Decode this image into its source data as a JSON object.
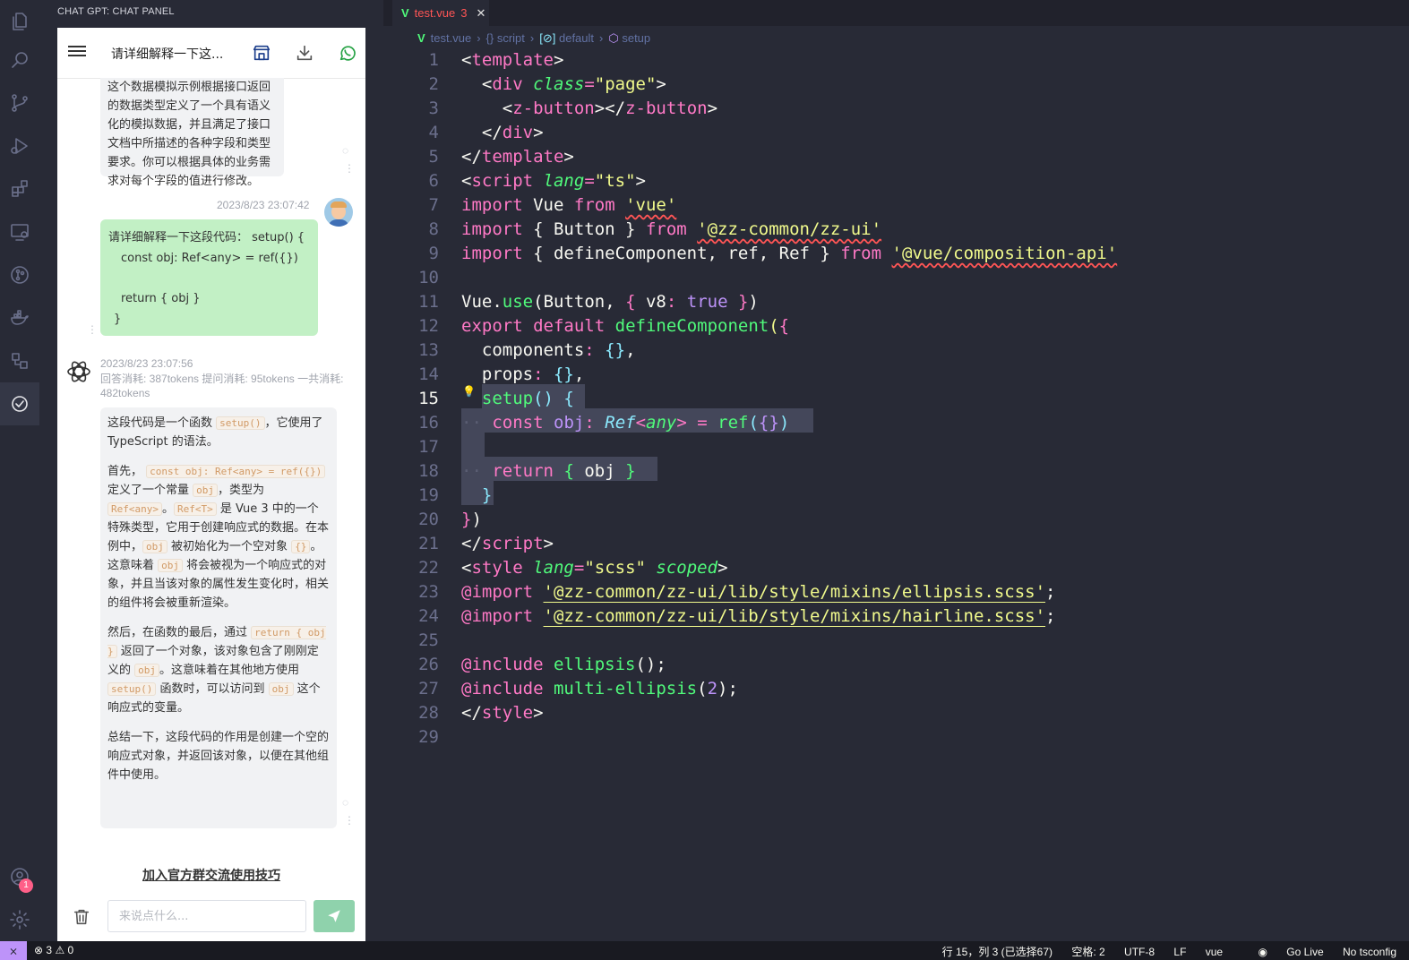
{
  "sidebar": {
    "title": "CHAT GPT: CHAT PANEL",
    "chat": {
      "header_title": "请详细解释一下这...",
      "prev_msg": "这个数据模拟示例根据接口返回的数据类型定义了一个具有语义化的模拟数据，并且满足了接口文档中所描述的各种字段和类型要求。你可以根据具体的业务需求对每个字段的值进行修改。",
      "user_time": "2023/8/23 23:07:42",
      "user_lines": [
        "请详细解释一下这段代码： setup() {",
        "const obj: Ref<any> = ref({})",
        "return { obj }",
        "}"
      ],
      "bot_time": "2023/8/23 23:07:56",
      "bot_tokens": "回答消耗: 387tokens   提问消耗: 95tokens   一共消耗: 482tokens",
      "reply": {
        "p1a": "这段代码是一个函数",
        "p1code": "setup()",
        "p1b": "，它使用了 TypeScript 的语法。",
        "p2a": "首先，",
        "p2code1": "const obj: Ref<any> = ref({})",
        "p2b": "定义了一个常量",
        "p2code2": "obj",
        "p2c": "，类型为",
        "p2code3": "Ref<any>",
        "p2d": "。",
        "p2code4": "Ref<T>",
        "p2e": "是 Vue 3 中的一个特殊类型，它用于创建响应式的数据。在本例中，",
        "p2code5": "obj",
        "p2f": "被初始化为一个空对象",
        "p2code6": "{}",
        "p2g": "。这意味着",
        "p2code7": "obj",
        "p2h": "将会被视为一个响应式的对象，并且当该对象的属性发生变化时，相关的组件将会被重新渲染。",
        "p3a": "然后，在函数的最后，通过",
        "p3code1": "return { obj }",
        "p3b": "返回了一个对象，该对象包含了刚刚定义的",
        "p3code2": "obj",
        "p3c": "。这意味着在其他地方使用",
        "p3code3": "setup()",
        "p3d": "函数时，可以访问到",
        "p3code4": "obj",
        "p3e": "这个响应式的变量。",
        "p4": "总结一下，这段代码的作用是创建一个空的响应式对象，并返回该对象，以便在其他组件中使用。"
      },
      "join_link": "加入官方群交流使用技巧",
      "input_placeholder": "来说点什么..."
    }
  },
  "activity": {
    "badge_count": "1"
  },
  "tab": {
    "name": "test.vue",
    "problems": "3",
    "icon": "V"
  },
  "breadcrumb": [
    "test.vue",
    "{} script",
    "default",
    "setup"
  ],
  "editor": {
    "current_line": 15,
    "line_numbers": [
      "1",
      "2",
      "3",
      "4",
      "5",
      "6",
      "7",
      "8",
      "9",
      "10",
      "11",
      "12",
      "13",
      "14",
      "15",
      "16",
      "17",
      "18",
      "19",
      "20",
      "21",
      "22",
      "23",
      "24",
      "25",
      "26",
      "27",
      "28",
      "29"
    ],
    "code": {
      "l1": [
        "<",
        "template",
        ">"
      ],
      "l2": [
        "<",
        "div",
        "class",
        "=",
        "\"page\"",
        ">"
      ],
      "l3": [
        "<",
        "z-button",
        "></",
        "z-button",
        ">"
      ],
      "l4": [
        "</",
        "div",
        ">"
      ],
      "l5": [
        "</",
        "template",
        ">"
      ],
      "l6": [
        "<",
        "script",
        "lang",
        "=",
        "\"ts\"",
        ">"
      ],
      "l7": [
        "import",
        "Vue",
        "from",
        "'vue'"
      ],
      "l8": [
        "import",
        "{ Button }",
        "from",
        "'@zz-common/zz-ui'"
      ],
      "l9": [
        "import",
        "{ defineComponent, ref, Ref }",
        "from",
        "'@vue/composition-api'"
      ],
      "l11": [
        "Vue",
        ".",
        "use",
        "(",
        "Button, ",
        "{",
        " v8",
        ":",
        " true",
        " }",
        ")"
      ],
      "l12": [
        "export",
        "default",
        "defineComponent",
        "(",
        "{"
      ],
      "l13": [
        "components",
        ":",
        " {}",
        ","
      ],
      "l14": [
        "props",
        ":",
        " {}",
        ","
      ],
      "l15": [
        "setup",
        "()",
        " {"
      ],
      "l16": [
        "const",
        "obj",
        ":",
        "Ref",
        "<",
        "any",
        ">",
        " = ",
        "ref",
        "(",
        "{}",
        ")"
      ],
      "l18": [
        "return",
        "{",
        " obj ",
        "}"
      ],
      "l19": [
        "}"
      ],
      "l20": [
        "}",
        ")"
      ],
      "l21": [
        "</",
        "script",
        ">"
      ],
      "l22": [
        "<",
        "style",
        "lang",
        "=",
        "\"scss\"",
        "scoped",
        ">"
      ],
      "l23": [
        "@import",
        "'@zz-common/zz-ui/lib/style/mixins/ellipsis.scss'",
        ";"
      ],
      "l24": [
        "@import",
        "'@zz-common/zz-ui/lib/style/mixins/hairline.scss'",
        ";"
      ],
      "l26": [
        "@include",
        "ellipsis",
        "();"
      ],
      "l27": [
        "@include",
        "multi-ellipsis",
        "(",
        "2",
        ");"
      ],
      "l28": [
        "</",
        "style",
        ">"
      ]
    }
  },
  "statusbar": {
    "errors": "3",
    "warnings": "0",
    "position": "行 15，列 3 (已选择67)",
    "spaces": "空格: 2",
    "encoding": "UTF-8",
    "eol": "LF",
    "language": "vue",
    "golive": "Go Live",
    "tsconfig": "No tsconfig"
  },
  "colors": {
    "accent_pink": "#ff79c6",
    "accent_green": "#50fa7b",
    "accent_yellow": "#f1fa8c",
    "accent_purple": "#bd93f9",
    "accent_cyan": "#8be9fd",
    "send_button": "#8fd2ac",
    "user_bubble": "#c2f0c5"
  }
}
